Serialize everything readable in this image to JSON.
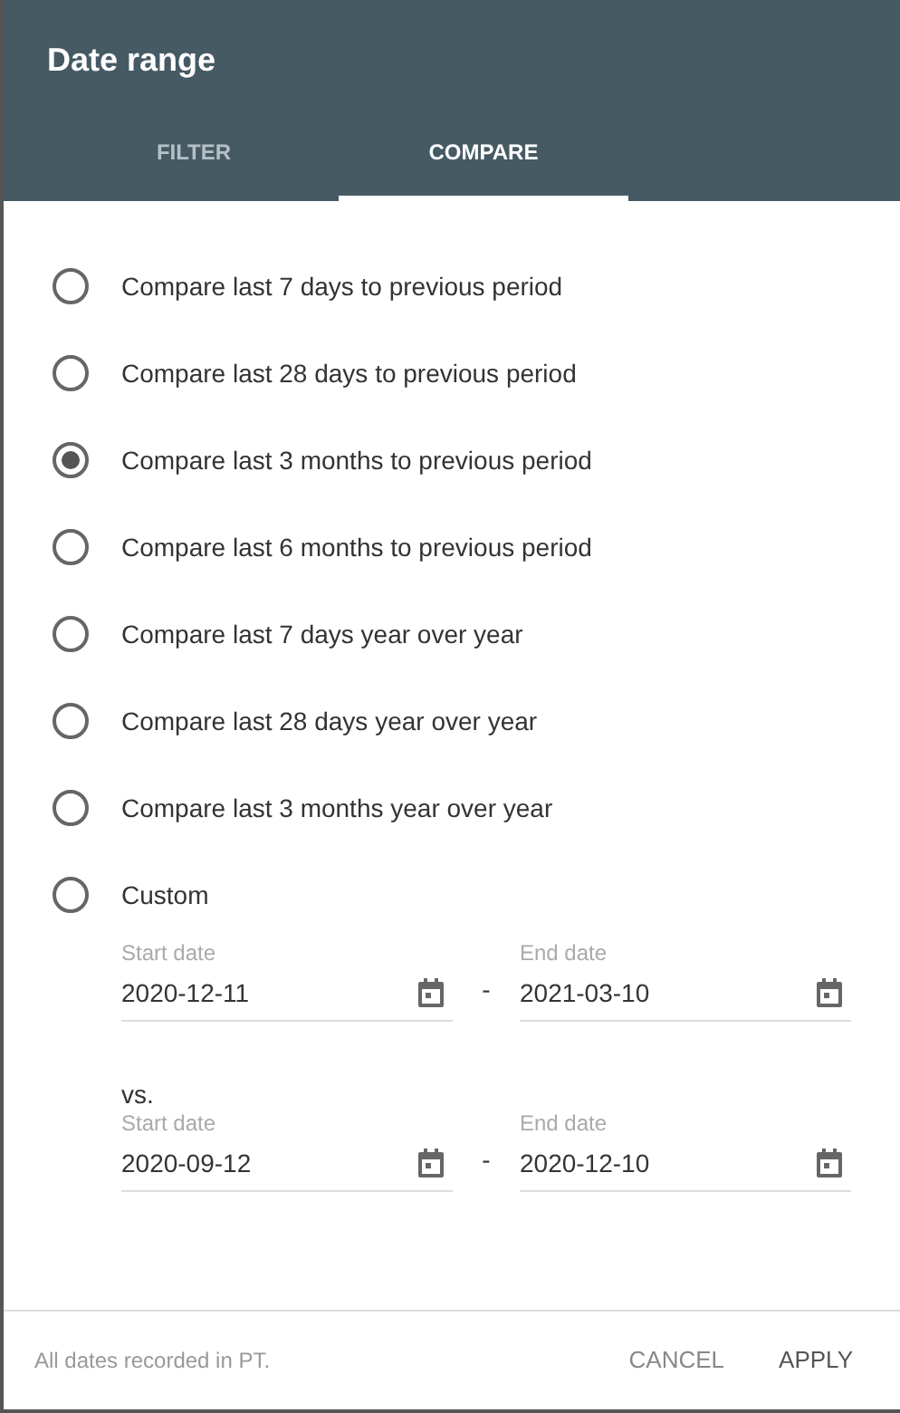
{
  "title": "Date range",
  "tabs": [
    {
      "label": "FILTER",
      "selected": false
    },
    {
      "label": "COMPARE",
      "selected": true
    }
  ],
  "options": [
    {
      "label": "Compare last 7 days to previous period",
      "selected": false
    },
    {
      "label": "Compare last 28 days to previous period",
      "selected": false
    },
    {
      "label": "Compare last 3 months to previous period",
      "selected": true
    },
    {
      "label": "Compare last 6 months to previous period",
      "selected": false
    },
    {
      "label": "Compare last 7 days year over year",
      "selected": false
    },
    {
      "label": "Compare last 28 days year over year",
      "selected": false
    },
    {
      "label": "Compare last 3 months year over year",
      "selected": false
    },
    {
      "label": "Custom",
      "selected": false
    }
  ],
  "ranges": [
    {
      "start": {
        "label": "Start date",
        "value": "2020-12-11"
      },
      "separator": "-",
      "end": {
        "label": "End date",
        "value": "2021-03-10"
      }
    },
    {
      "prefix": "vs.",
      "start": {
        "label": "Start date",
        "value": "2020-09-12"
      },
      "separator": "-",
      "end": {
        "label": "End date",
        "value": "2020-12-10"
      }
    }
  ],
  "footer": {
    "note": "All dates recorded in PT.",
    "buttons": [
      "CANCEL",
      "APPLY"
    ]
  }
}
